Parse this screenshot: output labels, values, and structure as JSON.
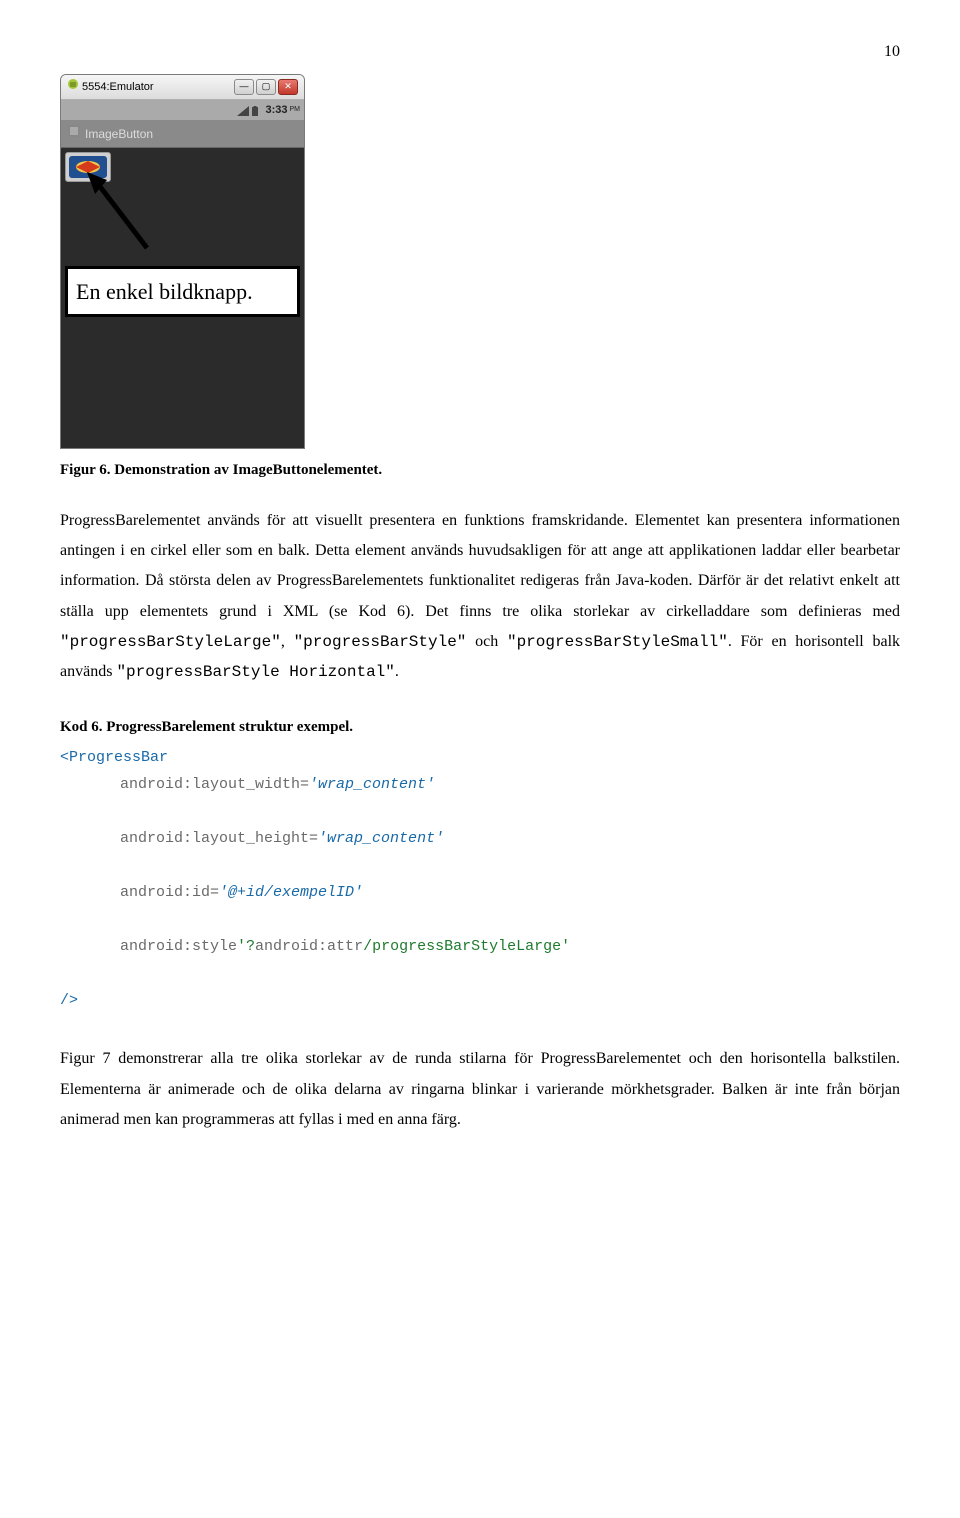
{
  "pageNumber": "10",
  "emulator": {
    "windowTitle": "5554:Emulator",
    "time": "3:33",
    "timeSuffix": "PM",
    "appHeader": "ImageButton",
    "callout": "En enkel bildknapp."
  },
  "caption1": "Figur 6. Demonstration av ImageButtonelementet.",
  "para1_parts": {
    "a": "ProgressBarelementet används för att visuellt presentera en funktions framskridande. Elementet kan presentera informationen antingen i en cirkel eller som en balk. Detta element används huvudsakligen för att ange att applikationen laddar eller bearbetar information. Då största delen av ProgressBarelementets funktionalitet redigeras från Java-koden. Därför är det relativt enkelt att ställa upp elementets grund i XML (se Kod 6). Det finns tre olika storlekar av cirkelladdare som definieras med ",
    "m1": "\"progressBarStyleLarge\"",
    "b": ", ",
    "m2": "\"progressBarStyle\"",
    "c": " och ",
    "m3": "\"progressBarStyleSmall\"",
    "d": ". För en horisontell balk används ",
    "m4": "\"progressBarStyle Horizontal\"",
    "e": "."
  },
  "codeHeading": "Kod 6. ProgressBarelement struktur exempel.",
  "code": {
    "open": "<ProgressBar",
    "l1a": "android:layout_width=",
    "l1b": "'wrap_content'",
    "l2a": "android:layout_height=",
    "l2b": "'wrap_content'",
    "l3a": "android:id=",
    "l3b": "'@+id/exempelID'",
    "l4a": "android:style",
    "l4q": "'?",
    "l4b": "android:attr",
    "l4c": "/",
    "l4d": "progressBarStyleLarge",
    "l4e": "'",
    "close": "/>"
  },
  "para2": "Figur 7 demonstrerar alla tre olika storlekar av de runda stilarna för ProgressBarelementet och den horisontella balkstilen. Elementerna är animerade och de olika delarna av ringarna blinkar i varierande mörkhetsgrader. Balken är inte från början animerad men kan programmeras att fyllas i med en anna färg."
}
